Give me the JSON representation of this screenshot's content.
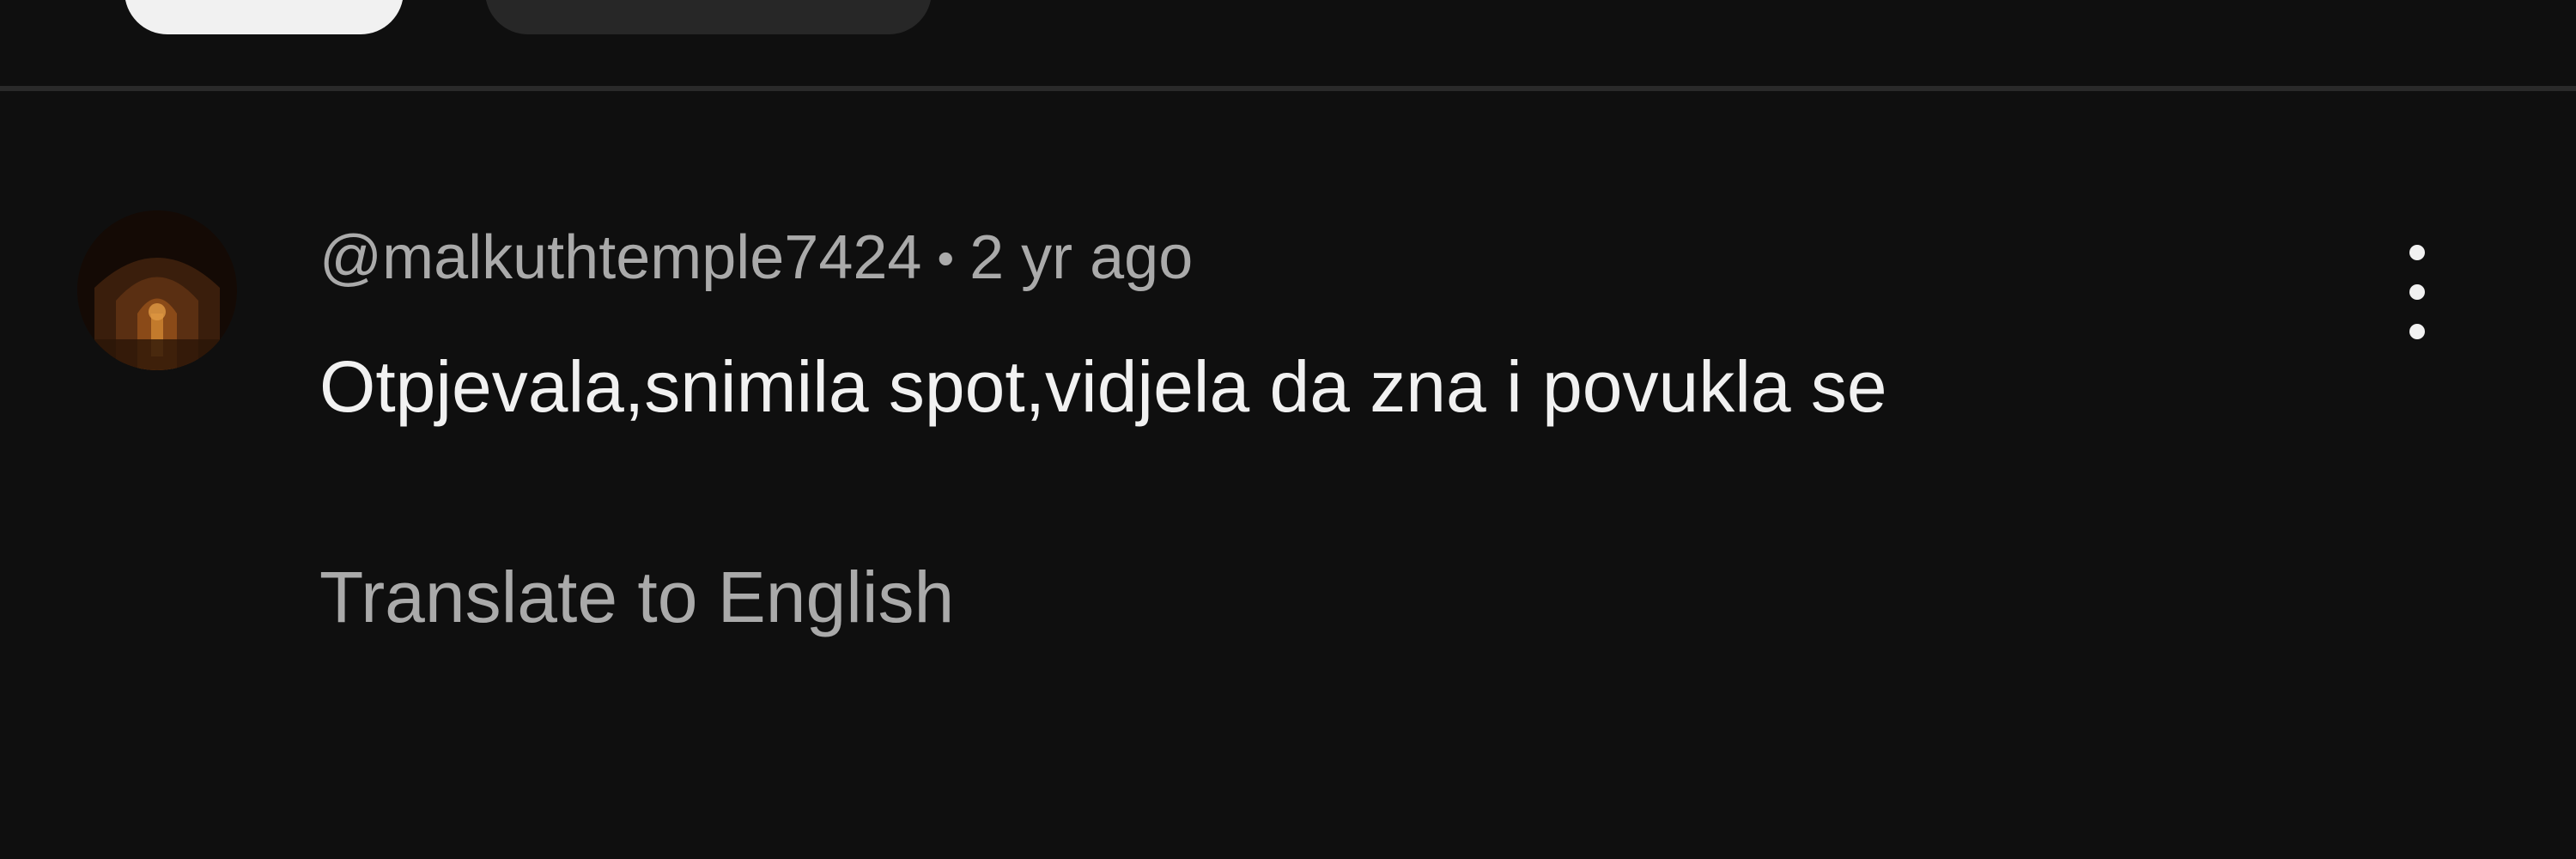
{
  "filter_chips": [
    {
      "label": "",
      "selected": true
    },
    {
      "label": "",
      "selected": false
    }
  ],
  "comment": {
    "handle": "@malkuthtemple7424",
    "separator": "•",
    "timestamp": "2 yr ago",
    "text": "Otpjevala,snimila spot,vidjela da zna i povukla se",
    "translate_label": "Translate to English",
    "menu_icon": "more-vertical-icon",
    "avatar_icon": "cathedral-avatar"
  },
  "colors": {
    "background": "#0f0f0f",
    "primary_text": "#f1f1f1",
    "secondary_text": "#aaaaaa",
    "chip_selected": "#f1f1f1",
    "chip_unselected": "#272727"
  }
}
